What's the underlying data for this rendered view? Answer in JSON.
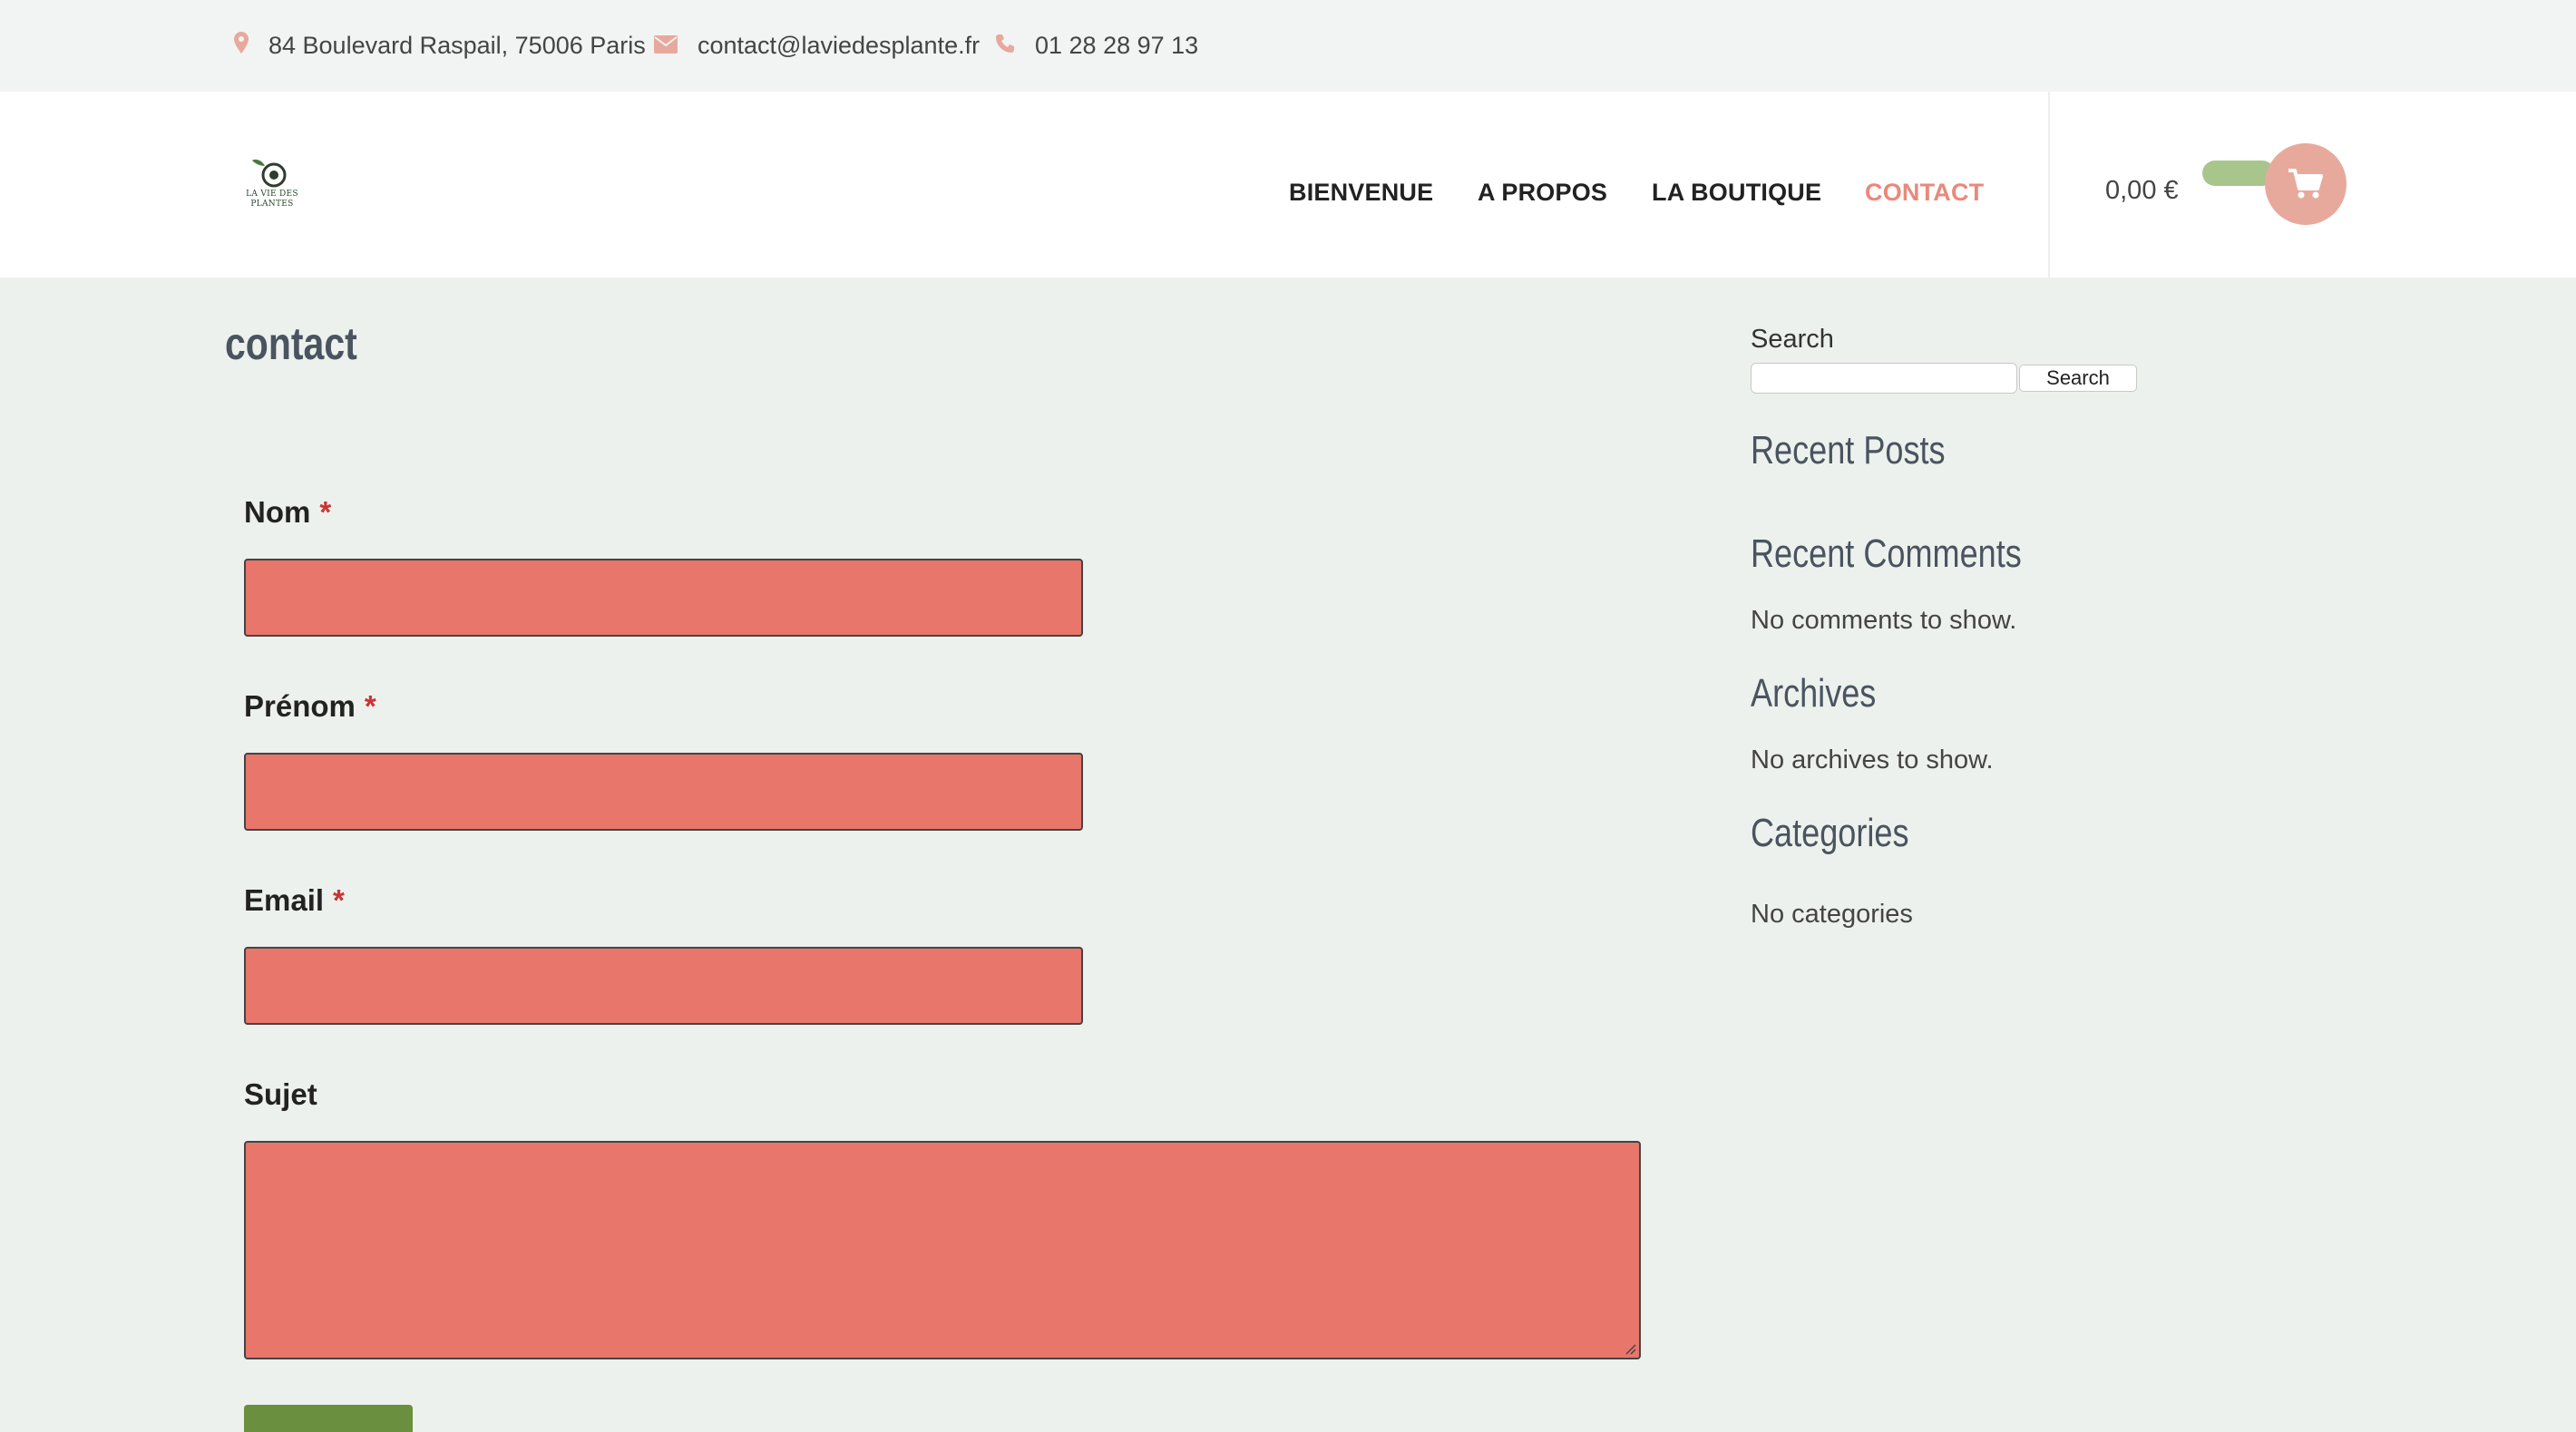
{
  "topbar": {
    "address": "84 Boulevard Raspail, 75006 Paris",
    "email": "contact@laviedesplante.fr",
    "phone": "01 28 28 97 13",
    "icon_color": "#e8a99d"
  },
  "header": {
    "logo_line1": "LA VIE DES",
    "logo_line2": "PLANTES",
    "nav": [
      "BIENVENUE",
      "A PROPOS",
      "LA BOUTIQUE",
      "CONTACT"
    ],
    "active_nav": "CONTACT",
    "cart_total": "0,00 €",
    "accent": "#e9897a",
    "cart_toggle_color": "#a8c58b"
  },
  "main": {
    "title": "contact",
    "form": {
      "fields": [
        {
          "label": "Nom",
          "required": "*",
          "value": ""
        },
        {
          "label": "Prénom",
          "required": "*",
          "value": ""
        },
        {
          "label": "Email",
          "required": "*",
          "value": ""
        },
        {
          "label": "Sujet",
          "value": ""
        }
      ],
      "field_color": "#e8766b"
    }
  },
  "sidebar": {
    "search_label": "Search",
    "search_value": "",
    "search_button": "Search",
    "recent_posts": "Recent Posts",
    "recent_comments": "Recent Comments",
    "no_comments": "No comments to show.",
    "archives": "Archives",
    "no_archives": "No archives to show.",
    "categories": "Categories",
    "no_categories": "No categories"
  }
}
